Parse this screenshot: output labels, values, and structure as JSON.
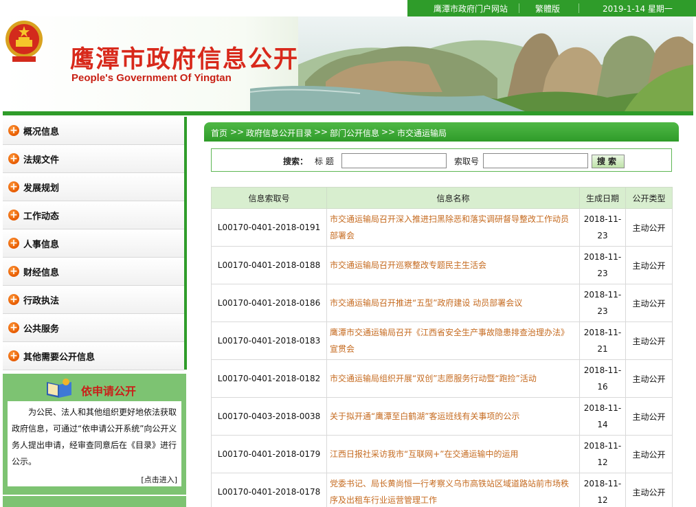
{
  "topbar": {
    "portal_link": "鹰潭市政府门户网站",
    "traditional_link": "繁體版",
    "date": "2019-1-14 星期一"
  },
  "banner": {
    "title_cn": "鹰潭市政府信息公开",
    "title_en": "People's Government Of Yingtan"
  },
  "sidebar": {
    "items": [
      {
        "label": "概况信息"
      },
      {
        "label": "法规文件"
      },
      {
        "label": "发展规划"
      },
      {
        "label": "工作动态"
      },
      {
        "label": "人事信息"
      },
      {
        "label": "财经信息"
      },
      {
        "label": "行政执法"
      },
      {
        "label": "公共服务"
      },
      {
        "label": "其他需要公开信息"
      }
    ],
    "apply": {
      "title": "依申请公开",
      "text": "为公民、法人和其他组织更好地依法获取政府信息，可通过“依申请公开系统”向公开义务人提出申请，经审查同意后在《目录》进行公示。",
      "enter": "[点击进入]"
    }
  },
  "breadcrumb": {
    "home": "首页",
    "sep": ">>",
    "catalog": "政府信息公开目录",
    "dept": "部门公开信息",
    "current": "市交通运输局"
  },
  "search": {
    "label": "搜索：",
    "title_label": "标  题",
    "title_value": "",
    "index_label": "索取号",
    "index_value": "",
    "button": "搜索"
  },
  "table": {
    "headers": [
      "信息索取号",
      "信息名称",
      "生成日期",
      "公开类型"
    ],
    "rows": [
      {
        "id": "L00170-0401-2018-0191",
        "name": "市交通运输局召开深入推进扫黑除恶和落实调研督导整改工作动员部署会",
        "date": "2018-11-23",
        "type": "主动公开"
      },
      {
        "id": "L00170-0401-2018-0188",
        "name": "市交通运输局召开巡察整改专题民主生活会",
        "date": "2018-11-23",
        "type": "主动公开"
      },
      {
        "id": "L00170-0401-2018-0186",
        "name": "市交通运输局召开推进“五型”政府建设 动员部署会议",
        "date": "2018-11-23",
        "type": "主动公开"
      },
      {
        "id": "L00170-0401-2018-0183",
        "name": "鹰潭市交通运输局召开《江西省安全生产事故隐患排查治理办法》宣贯会",
        "date": "2018-11-21",
        "type": "主动公开"
      },
      {
        "id": "L00170-0401-2018-0182",
        "name": "市交通运输局组织开展“双创”志愿服务行动暨“跑捡”活动",
        "date": "2018-11-16",
        "type": "主动公开"
      },
      {
        "id": "L00170-0403-2018-0038",
        "name": "关于拟开通“鹰潭至白鹤湖”客运班线有关事项的公示",
        "date": "2018-11-14",
        "type": "主动公开"
      },
      {
        "id": "L00170-0401-2018-0179",
        "name": "江西日报社采访我市“互联网+”在交通运输中的运用",
        "date": "2018-11-12",
        "type": "主动公开"
      },
      {
        "id": "L00170-0401-2018-0178",
        "name": "党委书记、局长黄尚恒一行考察义乌市高铁站区域道路站前市场秩序及出租车行业运营管理工作",
        "date": "2018-11-12",
        "type": "主动公开"
      }
    ]
  },
  "colors": {
    "brand_green": "#2f9c2a",
    "title_red": "#d8291b",
    "link_orange": "#c56a1f",
    "header_bg": "#d8eecf"
  }
}
